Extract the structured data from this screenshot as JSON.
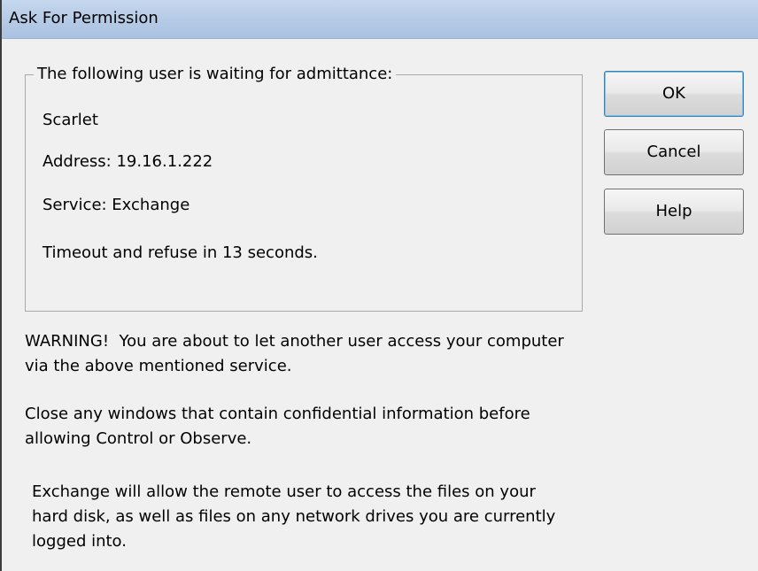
{
  "window": {
    "title": "Ask For Permission"
  },
  "group": {
    "legend": "The following user is waiting for admittance:",
    "user_name": "Scarlet",
    "address": "Address: 19.16.1.222",
    "service": "Service: Exchange",
    "timeout": "Timeout and  refuse in 13 seconds."
  },
  "buttons": {
    "ok": "OK",
    "cancel": "Cancel",
    "help": "Help"
  },
  "messages": {
    "warning_line1": "WARNING!  You are about to let another user access your computer",
    "warning_line2": "via the above mentioned service.",
    "close_line1": "Close any windows that contain confidential information before",
    "close_line2": "allowing Control or Observe.",
    "exchange_line1": "Exchange will allow the remote user to access the files on your",
    "exchange_line2": "hard disk, as well as files on any network drives you are currently",
    "exchange_line3": "logged into."
  },
  "colors": {
    "titlebar": "#b6cbe6",
    "dialog_background": "#f0f0f0",
    "default_button_border": "#3c7fb1"
  }
}
